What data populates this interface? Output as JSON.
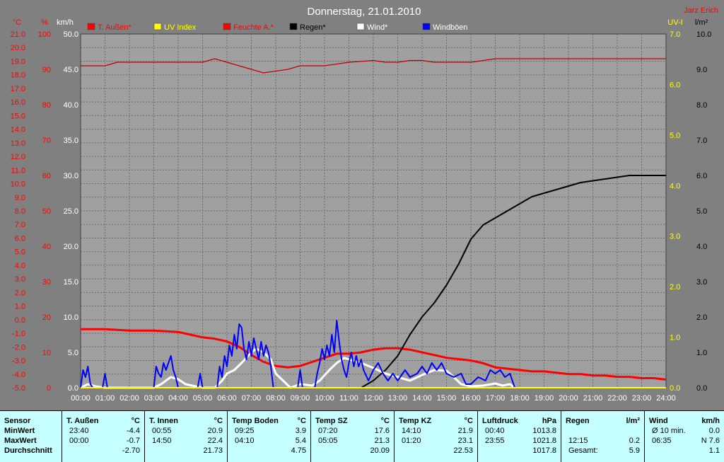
{
  "title": "Donnerstag, 21.01.2010",
  "author": "Jarz Erich",
  "colors": {
    "background": "#808080",
    "plot": "#a0a0a0",
    "temp": "#ff0000",
    "humidity": "#c00000",
    "rain": "#000000",
    "wind": "#ffffff",
    "gusts": "#0000ff",
    "uv": "#ffff00",
    "table_bg": "#c6ffff"
  },
  "axes": {
    "temp_unit": "°C",
    "temp_ticks": [
      "21.0",
      "20.0",
      "19.0",
      "18.0",
      "17.0",
      "16.0",
      "15.0",
      "14.0",
      "13.0",
      "12.0",
      "11.0",
      "10.0",
      "9.0",
      "8.0",
      "7.0",
      "6.0",
      "5.0",
      "4.0",
      "3.0",
      "2.0",
      "1.0",
      "0.0",
      "-1.0",
      "-2.0",
      "-3.0",
      "-4.0",
      "-5.0"
    ],
    "hum_unit": "%",
    "hum_ticks": [
      "100",
      "90",
      "80",
      "70",
      "60",
      "50",
      "40",
      "30",
      "20",
      "10",
      "0"
    ],
    "wind_unit": "km/h",
    "wind_ticks": [
      "50.0",
      "45.0",
      "40.0",
      "35.0",
      "30.0",
      "25.0",
      "20.0",
      "15.0",
      "10.0",
      "5.0",
      "0.0"
    ],
    "uv_unit": "UV-I",
    "uv_ticks": [
      "7.0",
      "6.0",
      "5.0",
      "4.0",
      "3.0",
      "2.0",
      "1.0",
      "0.0"
    ],
    "rain_unit": "l/m²",
    "rain_ticks": [
      "10.0",
      "9.0",
      "8.0",
      "7.0",
      "6.0",
      "5.0",
      "4.0",
      "3.0",
      "2.0",
      "1.0",
      "0.0"
    ],
    "x_ticks": [
      "00:00",
      "01:00",
      "02:00",
      "03:00",
      "04:00",
      "05:00",
      "06:00",
      "07:00",
      "08:00",
      "09:00",
      "10:00",
      "11:00",
      "12:00",
      "13:00",
      "14:00",
      "15:00",
      "16:00",
      "17:00",
      "18:00",
      "19:00",
      "20:00",
      "21:00",
      "22:00",
      "23:00",
      "24:00"
    ]
  },
  "legend": [
    {
      "label": "T. Außen*",
      "color": "#ff0000"
    },
    {
      "label": "UV Index",
      "color": "#ffff00"
    },
    {
      "label": "Feuchte A.*",
      "color": "#ff0000"
    },
    {
      "label": "Regen*",
      "color": "#000000"
    },
    {
      "label": "Wind*",
      "color": "#ffffff"
    },
    {
      "label": "Windböen",
      "color": "#0000ff"
    }
  ],
  "chart_data": {
    "type": "line",
    "title": "Donnerstag, 21.01.2010",
    "x_range_hours": [
      0,
      24
    ],
    "grid": true,
    "legend_position": "top",
    "series": [
      {
        "name": "T. Außen*",
        "axis": "temp",
        "ylim": [
          -5,
          21
        ],
        "color": "#ff0000",
        "points": [
          [
            0,
            -0.7
          ],
          [
            1,
            -0.7
          ],
          [
            2,
            -0.8
          ],
          [
            3,
            -0.8
          ],
          [
            4,
            -0.9
          ],
          [
            4.5,
            -1.1
          ],
          [
            5,
            -1.3
          ],
          [
            5.5,
            -1.4
          ],
          [
            6,
            -1.6
          ],
          [
            6.5,
            -2.0
          ],
          [
            7,
            -2.6
          ],
          [
            7.5,
            -3.1
          ],
          [
            8,
            -3.4
          ],
          [
            8.5,
            -3.5
          ],
          [
            9,
            -3.4
          ],
          [
            9.5,
            -3.1
          ],
          [
            10,
            -2.8
          ],
          [
            10.5,
            -2.5
          ],
          [
            11,
            -2.5
          ],
          [
            11.5,
            -2.4
          ],
          [
            12,
            -2.2
          ],
          [
            12.5,
            -2.1
          ],
          [
            13,
            -2.1
          ],
          [
            13.5,
            -2.2
          ],
          [
            14,
            -2.4
          ],
          [
            14.5,
            -2.6
          ],
          [
            15,
            -2.8
          ],
          [
            15.5,
            -2.9
          ],
          [
            16,
            -3.0
          ],
          [
            16.5,
            -3.2
          ],
          [
            17,
            -3.5
          ],
          [
            17.5,
            -3.6
          ],
          [
            18,
            -3.7
          ],
          [
            18.5,
            -3.8
          ],
          [
            19,
            -3.8
          ],
          [
            19.5,
            -3.9
          ],
          [
            20,
            -4.0
          ],
          [
            20.5,
            -4.0
          ],
          [
            21,
            -4.1
          ],
          [
            21.5,
            -4.1
          ],
          [
            22,
            -4.2
          ],
          [
            22.5,
            -4.2
          ],
          [
            23,
            -4.3
          ],
          [
            23.5,
            -4.3
          ],
          [
            24,
            -4.4
          ]
        ]
      },
      {
        "name": "Feuchte A.*",
        "axis": "humidity",
        "ylim": [
          0,
          100
        ],
        "color": "#c00000",
        "points": [
          [
            0,
            91
          ],
          [
            1,
            91
          ],
          [
            1.5,
            92
          ],
          [
            2,
            92
          ],
          [
            3,
            92
          ],
          [
            4,
            92
          ],
          [
            5,
            92
          ],
          [
            5.5,
            93
          ],
          [
            6,
            92
          ],
          [
            6.5,
            91
          ],
          [
            7,
            90
          ],
          [
            7.5,
            89
          ],
          [
            8,
            89.5
          ],
          [
            8.5,
            90
          ],
          [
            9,
            91
          ],
          [
            10,
            91
          ],
          [
            11,
            92
          ],
          [
            12,
            92.5
          ],
          [
            12.5,
            92
          ],
          [
            13,
            92
          ],
          [
            13.5,
            92.5
          ],
          [
            14,
            92.5
          ],
          [
            14.5,
            92
          ],
          [
            15,
            92
          ],
          [
            16,
            92
          ],
          [
            16.5,
            92.5
          ],
          [
            17,
            93
          ],
          [
            18,
            93
          ],
          [
            20,
            93
          ],
          [
            22,
            93
          ],
          [
            24,
            93
          ]
        ]
      },
      {
        "name": "Regen*",
        "axis": "rain",
        "ylim": [
          0,
          10
        ],
        "color": "#000000",
        "points": [
          [
            11.5,
            0
          ],
          [
            12,
            0.2
          ],
          [
            12.5,
            0.5
          ],
          [
            13,
            0.9
          ],
          [
            13.5,
            1.5
          ],
          [
            14,
            2.0
          ],
          [
            14.5,
            2.4
          ],
          [
            15,
            2.9
          ],
          [
            15.5,
            3.5
          ],
          [
            16,
            4.2
          ],
          [
            16.5,
            4.6
          ],
          [
            17,
            4.8
          ],
          [
            17.5,
            5.0
          ],
          [
            18,
            5.2
          ],
          [
            18.5,
            5.4
          ],
          [
            19,
            5.5
          ],
          [
            19.5,
            5.6
          ],
          [
            20,
            5.7
          ],
          [
            20.5,
            5.8
          ],
          [
            21,
            5.85
          ],
          [
            21.5,
            5.9
          ],
          [
            22,
            5.95
          ],
          [
            22.5,
            6.0
          ],
          [
            23,
            6.0
          ],
          [
            24,
            6.0
          ]
        ]
      },
      {
        "name": "Wind*",
        "axis": "wind",
        "ylim": [
          0,
          50
        ],
        "color": "#ffffff",
        "points": [
          [
            0,
            0
          ],
          [
            0.3,
            0.5
          ],
          [
            0.6,
            0.2
          ],
          [
            1,
            0
          ],
          [
            3,
            0
          ],
          [
            3.3,
            0.5
          ],
          [
            3.7,
            1.5
          ],
          [
            4,
            1.2
          ],
          [
            4.3,
            0.5
          ],
          [
            4.7,
            0.2
          ],
          [
            5,
            0
          ],
          [
            5.5,
            0
          ],
          [
            5.8,
            1.0
          ],
          [
            6,
            2.0
          ],
          [
            6.3,
            2.5
          ],
          [
            6.6,
            3.5
          ],
          [
            7,
            5.0
          ],
          [
            7.2,
            5.5
          ],
          [
            7.5,
            5.0
          ],
          [
            7.8,
            4.0
          ],
          [
            8,
            2.0
          ],
          [
            8.3,
            1.0
          ],
          [
            8.6,
            0
          ],
          [
            9,
            0.5
          ],
          [
            9.5,
            0.3
          ],
          [
            9.8,
            1.0
          ],
          [
            10.2,
            2.5
          ],
          [
            10.5,
            3.5
          ],
          [
            10.8,
            4.2
          ],
          [
            11,
            4.0
          ],
          [
            11.5,
            3.5
          ],
          [
            12,
            2.8
          ],
          [
            12.5,
            2.0
          ],
          [
            13,
            1.5
          ],
          [
            13.5,
            1.0
          ],
          [
            14,
            1.8
          ],
          [
            14.5,
            2.5
          ],
          [
            15,
            2.4
          ],
          [
            15.3,
            1.5
          ],
          [
            15.6,
            0.5
          ],
          [
            16,
            0.2
          ],
          [
            16.5,
            0.3
          ],
          [
            17,
            0.6
          ],
          [
            17.3,
            0.3
          ],
          [
            17.6,
            0.5
          ],
          [
            17.8,
            0
          ]
        ]
      },
      {
        "name": "Windböen",
        "axis": "wind",
        "ylim": [
          0,
          50
        ],
        "color": "#0000ff",
        "points": [
          [
            0,
            0
          ],
          [
            0.1,
            2.5
          ],
          [
            0.2,
            1.5
          ],
          [
            0.3,
            3.0
          ],
          [
            0.4,
            0.5
          ],
          [
            0.5,
            0
          ],
          [
            0.9,
            0
          ],
          [
            1,
            2.0
          ],
          [
            1.1,
            0
          ],
          [
            3,
            0
          ],
          [
            3.1,
            3.0
          ],
          [
            3.2,
            2.0
          ],
          [
            3.3,
            1.5
          ],
          [
            3.4,
            3.5
          ],
          [
            3.5,
            2.5
          ],
          [
            3.6,
            3.5
          ],
          [
            3.7,
            4.5
          ],
          [
            3.8,
            2.5
          ],
          [
            3.9,
            1.5
          ],
          [
            4,
            0
          ],
          [
            4.8,
            0
          ],
          [
            4.9,
            2.0
          ],
          [
            5,
            0
          ],
          [
            5.6,
            0
          ],
          [
            5.7,
            3.0
          ],
          [
            5.8,
            1.5
          ],
          [
            5.9,
            4.5
          ],
          [
            6,
            3.0
          ],
          [
            6.1,
            6.0
          ],
          [
            6.2,
            4.5
          ],
          [
            6.3,
            7.5
          ],
          [
            6.4,
            5.5
          ],
          [
            6.5,
            9.0
          ],
          [
            6.6,
            8.5
          ],
          [
            6.7,
            5.5
          ],
          [
            6.8,
            4.0
          ],
          [
            6.9,
            6.5
          ],
          [
            7,
            4.5
          ],
          [
            7.1,
            7.0
          ],
          [
            7.2,
            5.5
          ],
          [
            7.3,
            4.0
          ],
          [
            7.4,
            6.5
          ],
          [
            7.5,
            4.5
          ],
          [
            7.6,
            6.0
          ],
          [
            7.7,
            5.0
          ],
          [
            7.8,
            3.0
          ],
          [
            7.9,
            0
          ],
          [
            8.9,
            0
          ],
          [
            9,
            2.5
          ],
          [
            9.1,
            0
          ],
          [
            9.6,
            0
          ],
          [
            9.7,
            2.0
          ],
          [
            9.8,
            3.5
          ],
          [
            9.9,
            5.5
          ],
          [
            10,
            4.0
          ],
          [
            10.1,
            6.0
          ],
          [
            10.2,
            4.5
          ],
          [
            10.3,
            7.5
          ],
          [
            10.4,
            5.0
          ],
          [
            10.5,
            9.5
          ],
          [
            10.6,
            6.5
          ],
          [
            10.7,
            4.0
          ],
          [
            10.8,
            2.5
          ],
          [
            10.9,
            1.5
          ],
          [
            11,
            3.5
          ],
          [
            11.1,
            5.0
          ],
          [
            11.2,
            3.0
          ],
          [
            11.3,
            4.5
          ],
          [
            11.4,
            3.0
          ],
          [
            11.5,
            4.0
          ],
          [
            11.6,
            2.5
          ],
          [
            11.8,
            1.0
          ],
          [
            12,
            2.5
          ],
          [
            12.2,
            3.5
          ],
          [
            12.4,
            2.0
          ],
          [
            12.6,
            1.0
          ],
          [
            12.8,
            2.0
          ],
          [
            13,
            1.0
          ],
          [
            13.3,
            2.5
          ],
          [
            13.5,
            1.5
          ],
          [
            13.8,
            2.0
          ],
          [
            14,
            3.0
          ],
          [
            14.2,
            2.0
          ],
          [
            14.4,
            3.5
          ],
          [
            14.6,
            2.5
          ],
          [
            14.8,
            3.5
          ],
          [
            15,
            2.0
          ],
          [
            15.3,
            1.5
          ],
          [
            15.6,
            2.0
          ],
          [
            15.8,
            0.5
          ],
          [
            16,
            0.5
          ],
          [
            16.3,
            1.5
          ],
          [
            16.6,
            1.0
          ],
          [
            16.8,
            2.5
          ],
          [
            17,
            2.0
          ],
          [
            17.2,
            2.5
          ],
          [
            17.4,
            1.5
          ],
          [
            17.6,
            2.0
          ],
          [
            17.8,
            0
          ]
        ]
      },
      {
        "name": "UV Index",
        "axis": "uv",
        "ylim": [
          0,
          7
        ],
        "color": "#ffff00",
        "points": [
          [
            0,
            0
          ],
          [
            24,
            0
          ]
        ]
      }
    ]
  },
  "table": {
    "row_labels": [
      "Sensor",
      "MinWert",
      "MaxWert",
      "Durchschnitt"
    ],
    "columns": [
      {
        "name": "T. Außen",
        "unit": "°C",
        "min_time": "23:40",
        "min": "-4.4",
        "max_time": "00:00",
        "max": "-0.7",
        "avg": "-2.70"
      },
      {
        "name": "T. Innen",
        "unit": "°C",
        "min_time": "00:55",
        "min": "20.9",
        "max_time": "14:50",
        "max": "22.4",
        "avg": "21.73"
      },
      {
        "name": "Temp Boden",
        "unit": "°C",
        "min_time": "09:25",
        "min": "3.9",
        "max_time": "04:10",
        "max": "5.4",
        "avg": "4.75"
      },
      {
        "name": "Temp SZ",
        "unit": "°C",
        "min_time": "07:20",
        "min": "17.6",
        "max_time": "05:05",
        "max": "21.3",
        "avg": "20.09"
      },
      {
        "name": "Temp KZ",
        "unit": "°C",
        "min_time": "14:10",
        "min": "21.9",
        "max_time": "01:20",
        "max": "23.1",
        "avg": "22.53"
      },
      {
        "name": "Luftdruck",
        "unit": "hPa",
        "min_time": "00:40",
        "min": "1013.8",
        "max_time": "23:55",
        "max": "1021.8",
        "avg": "1017.8"
      },
      {
        "name": "Regen",
        "unit": "l/m²",
        "min_time": "",
        "min": "",
        "max_time": "12:15",
        "max": "0.2",
        "avg_label": "Gesamt:",
        "avg": "5.9"
      },
      {
        "name": "Wind",
        "unit": "km/h",
        "min_time": "Ø 10 min.",
        "min": "0.0",
        "max_time": "06:35",
        "max": "N 7.6",
        "avg": "1.1"
      }
    ]
  }
}
